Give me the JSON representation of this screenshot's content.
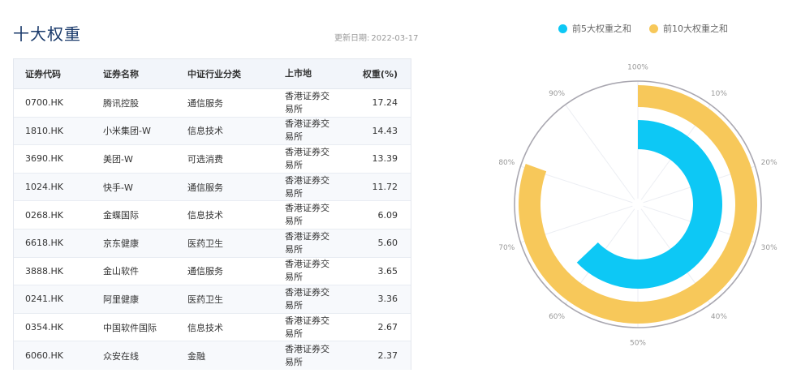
{
  "header": {
    "title": "十大权重",
    "update_label": "更新日期:",
    "update_date": "2022-03-17"
  },
  "table": {
    "columns": [
      "证券代码",
      "证券名称",
      "中证行业分类",
      "上市地",
      "权重(%)"
    ],
    "rows": [
      {
        "code": "0700.HK",
        "name": "腾讯控股",
        "industry": "通信服务",
        "market_line1": "香港证券交",
        "market_line2": "易所",
        "weight": "17.24"
      },
      {
        "code": "1810.HK",
        "name": "小米集团-W",
        "industry": "信息技术",
        "market_line1": "香港证券交",
        "market_line2": "易所",
        "weight": "14.43"
      },
      {
        "code": "3690.HK",
        "name": "美团-W",
        "industry": "可选消费",
        "market_line1": "香港证券交",
        "market_line2": "易所",
        "weight": "13.39"
      },
      {
        "code": "1024.HK",
        "name": "快手-W",
        "industry": "通信服务",
        "market_line1": "香港证券交",
        "market_line2": "易所",
        "weight": "11.72"
      },
      {
        "code": "0268.HK",
        "name": "金蝶国际",
        "industry": "信息技术",
        "market_line1": "香港证券交",
        "market_line2": "易所",
        "weight": "6.09"
      },
      {
        "code": "6618.HK",
        "name": "京东健康",
        "industry": "医药卫生",
        "market_line1": "香港证券交",
        "market_line2": "易所",
        "weight": "5.60"
      },
      {
        "code": "3888.HK",
        "name": "金山软件",
        "industry": "通信服务",
        "market_line1": "香港证券交",
        "market_line2": "易所",
        "weight": "3.65"
      },
      {
        "code": "0241.HK",
        "name": "阿里健康",
        "industry": "医药卫生",
        "market_line1": "香港证券交",
        "market_line2": "易所",
        "weight": "3.36"
      },
      {
        "code": "0354.HK",
        "name": "中国软件国际",
        "industry": "信息技术",
        "market_line1": "香港证券交",
        "market_line2": "易所",
        "weight": "2.67"
      },
      {
        "code": "6060.HK",
        "name": "众安在线",
        "industry": "金融",
        "market_line1": "香港证券交",
        "market_line2": "易所",
        "weight": "2.37"
      }
    ]
  },
  "chart_data": {
    "type": "polar-bar",
    "series": [
      {
        "name": "前5大权重之和",
        "value": 62.87,
        "color": "#0dc8f5"
      },
      {
        "name": "前10大权重之和",
        "value": 80.52,
        "color": "#f7c85a"
      }
    ],
    "angle_axis": {
      "min": 0,
      "max": 100,
      "tick_labels": [
        "10%",
        "20%",
        "30%",
        "40%",
        "50%",
        "60%",
        "70%",
        "80%",
        "90%",
        "100%"
      ]
    }
  }
}
